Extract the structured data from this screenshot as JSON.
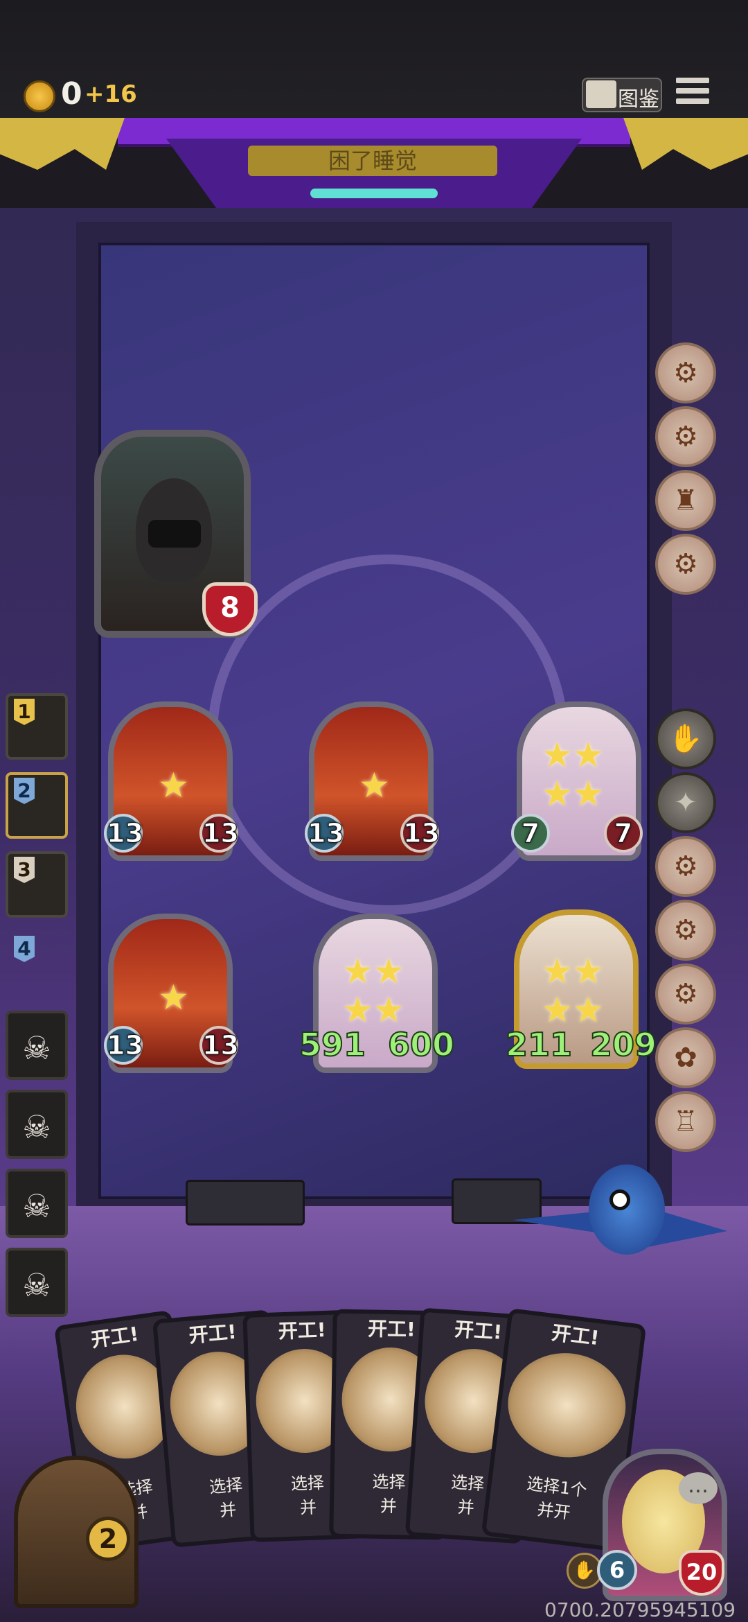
{
  "header": {
    "gold": "0",
    "gold_delta": "+16",
    "codex_label": "图鉴"
  },
  "stage": {
    "sign_text": "困了睡觉"
  },
  "enemy": {
    "health": "8"
  },
  "board": {
    "units": [
      {
        "attack": "13",
        "health": "13",
        "kind": "red-hood"
      },
      {
        "attack": "13",
        "health": "13",
        "kind": "red-hood"
      },
      {
        "attack": "7",
        "health": "7",
        "kind": "pastel"
      },
      {
        "attack": "13",
        "health": "13",
        "kind": "red-hood"
      },
      {
        "attack": "591",
        "health": "600",
        "kind": "pig"
      },
      {
        "attack": "211",
        "health": "209",
        "kind": "bull"
      }
    ]
  },
  "left_panel": {
    "ranks": [
      "1",
      "2",
      "3",
      "4"
    ]
  },
  "hand": {
    "cards": [
      {
        "title": "开工!",
        "desc": "选择",
        "desc2": "并"
      },
      {
        "title": "开工!",
        "desc": "选择",
        "desc2": "并"
      },
      {
        "title": "开工!",
        "desc": "选择",
        "desc2": "并"
      },
      {
        "title": "开工!",
        "desc": "选择",
        "desc2": "并"
      },
      {
        "title": "开工!",
        "desc": "选择",
        "desc2": "并"
      },
      {
        "title": "开工!",
        "desc": "选择1个",
        "desc2": "并开"
      }
    ]
  },
  "player": {
    "deck_count": "2",
    "attack": "6",
    "health": "20"
  },
  "version_text": "0700.20795945109",
  "colors": {
    "accent_purple": "#7c2bd1",
    "gold": "#e4b845",
    "health_red": "#b91c2a",
    "big_stat_green": "#9ef07a"
  }
}
